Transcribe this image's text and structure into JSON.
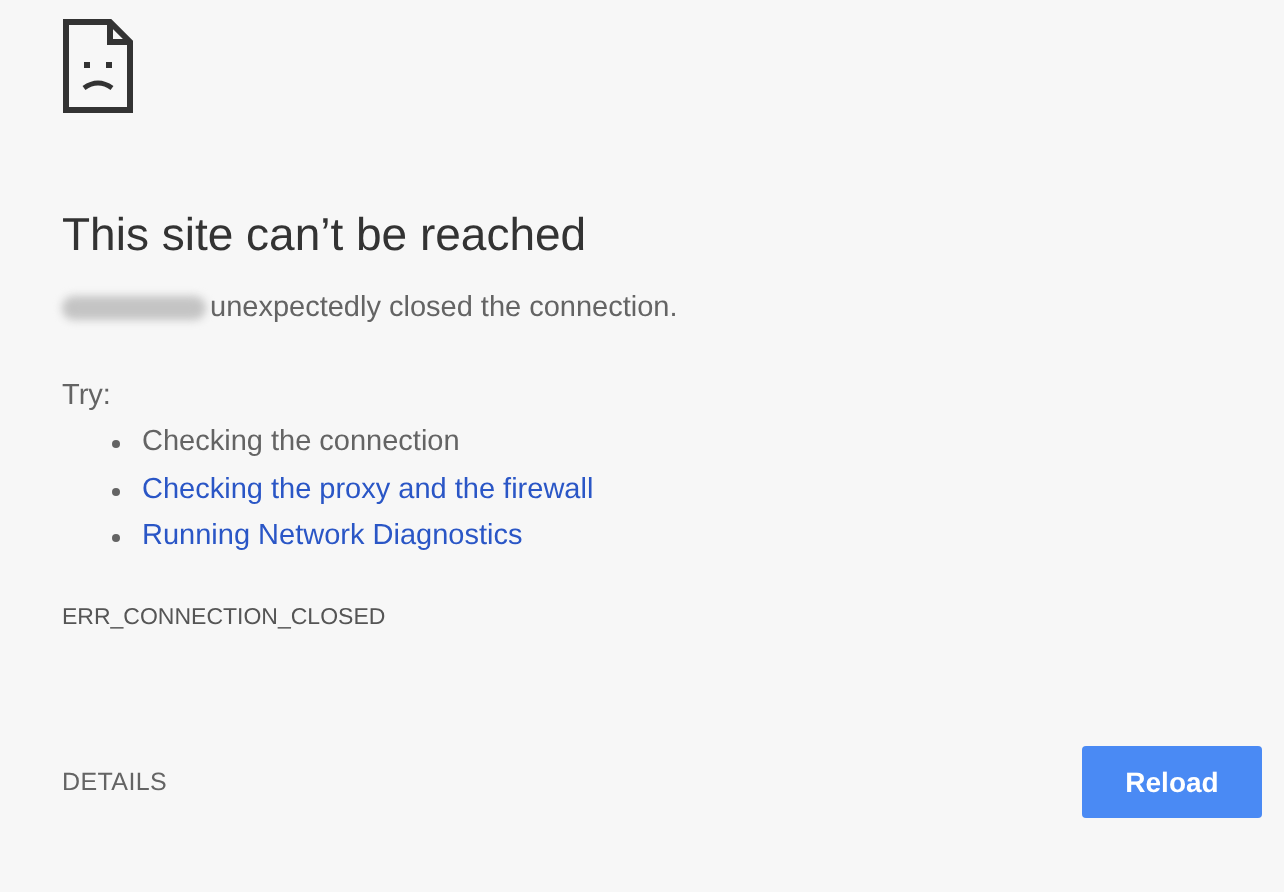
{
  "heading": "This site can’t be reached",
  "message": "unexpectedly closed the connection.",
  "suggestions": {
    "label": "Try:",
    "items": [
      {
        "kind": "text",
        "text": "Checking the connection"
      },
      {
        "kind": "link",
        "text": "Checking the proxy and the firewall"
      },
      {
        "kind": "link",
        "text": "Running Network Diagnostics"
      }
    ]
  },
  "error_code": "ERR_CONNECTION_CLOSED",
  "details_button": "DETAILS",
  "reload_button": "Reload"
}
